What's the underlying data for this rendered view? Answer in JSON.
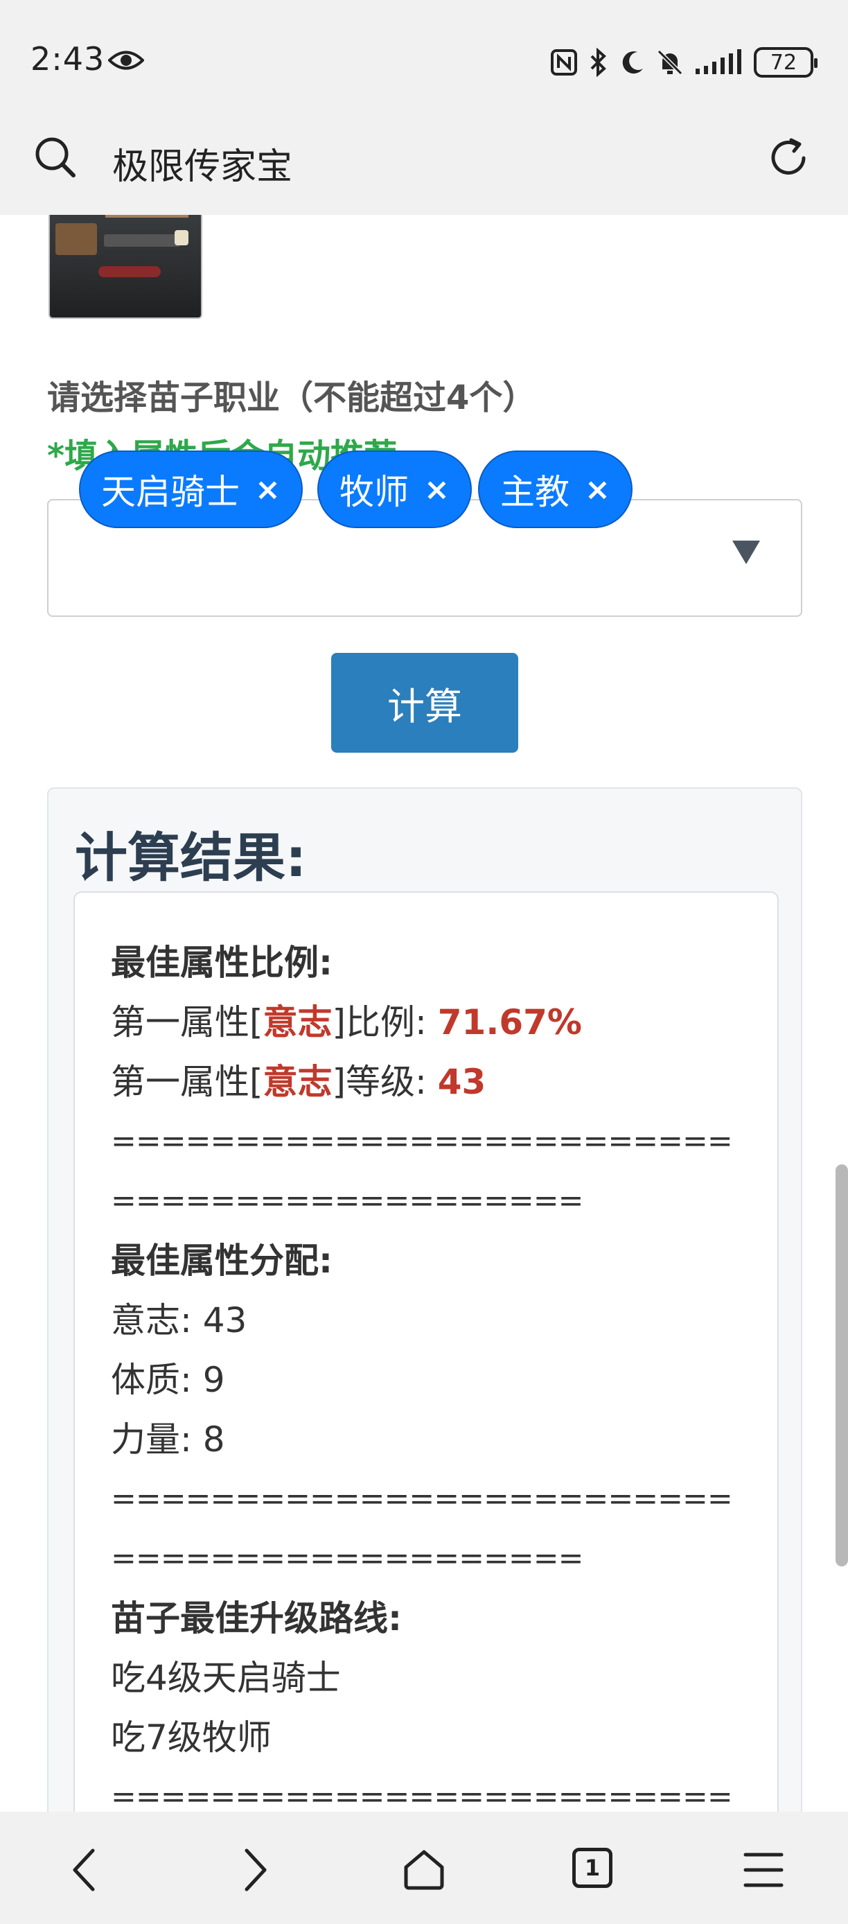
{
  "status": {
    "time": "2:43",
    "battery": "72",
    "icons": [
      "eye-icon",
      "nfc-icon",
      "bluetooth-icon",
      "moon-icon",
      "bell-muted-icon",
      "signal-icon",
      "battery-icon"
    ]
  },
  "search": {
    "query": "极限传家宝"
  },
  "form": {
    "label": "请选择苗子职业（不能超过4个）",
    "hint": "*填入属性后会自动推荐",
    "tags": [
      "天启骑士",
      "牧师",
      "主教"
    ],
    "remove_symbol": "×",
    "calc_button": "计算"
  },
  "result": {
    "title": "计算结果:",
    "ratio_heading": "最佳属性比例:",
    "ratio_prefix": "第一属性[",
    "ratio_attr": "意志",
    "ratio_suffix": "]比例: ",
    "ratio_value": "71.67%",
    "level_prefix": "第一属性[",
    "level_attr": "意志",
    "level_suffix": "]等级: ",
    "level_value": "43",
    "separator_a": "================================",
    "separator_b": "===================",
    "dist_heading": "最佳属性分配:",
    "dist": [
      "意志: 43",
      "体质: 9",
      "力量: 8"
    ],
    "route_heading": "苗子最佳升级路线:",
    "route": [
      "吃4级天启骑士",
      "吃7级牧师"
    ]
  },
  "nav": {
    "tab_count": "1",
    "icons": [
      "back-icon",
      "forward-icon",
      "home-icon",
      "tabs-icon",
      "menu-icon"
    ]
  },
  "colors": {
    "accent_blue": "#0a7bff",
    "button_blue": "#2a7fbc",
    "hint_green": "#2ea84a",
    "value_red": "#c0392b",
    "title_navy": "#2c3e50"
  }
}
